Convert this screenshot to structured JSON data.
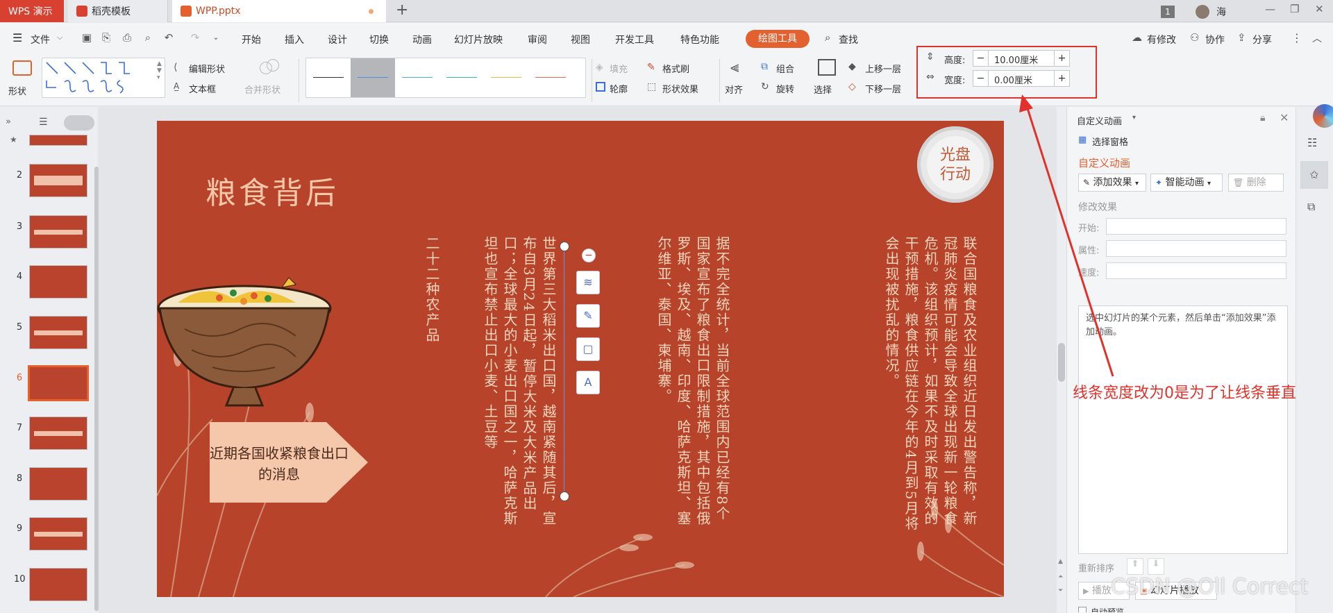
{
  "tabs": {
    "app": "WPS 演示",
    "template": "稻壳模板",
    "file": "WPP.pptx",
    "new_tab": "+"
  },
  "titlebar": {
    "page_badge": "1",
    "user": "海"
  },
  "menu": {
    "file": "文件",
    "items": [
      "开始",
      "插入",
      "设计",
      "切换",
      "动画",
      "幻灯片放映",
      "审阅",
      "视图",
      "开发工具",
      "特色功能"
    ],
    "active": "绘图工具",
    "search": "查找",
    "right": {
      "modified": "有修改",
      "collab": "协作",
      "share": "分享"
    }
  },
  "toolbar": {
    "shape": "形状",
    "edit_shape": "编辑形状",
    "textbox": "文本框",
    "merge_shape": "合并形状",
    "fill": "填充",
    "format_brush": "格式刷",
    "outline": "轮廓",
    "shape_effect": "形状效果",
    "align": "对齐",
    "group": "组合",
    "rotate": "旋转",
    "select": "选择",
    "bring_forward": "上移一层",
    "send_backward": "下移一层",
    "height_label": "高度:",
    "height_value": "10.00厘米",
    "width_label": "宽度:",
    "width_value": "0.00厘米",
    "minus": "−",
    "plus": "+"
  },
  "line_styles": [
    "#333333",
    "#4a90d9",
    "#4bb3c8",
    "#3bb8a0",
    "#e8b84a",
    "#e06a4a"
  ],
  "slides": {
    "numbers": [
      "2",
      "3",
      "4",
      "5",
      "6",
      "7",
      "8",
      "9",
      "10"
    ],
    "selected": "6"
  },
  "slide": {
    "title": "粮食背后",
    "badge_line1": "光盘",
    "badge_line2": "行动",
    "callout": "近期各国收紧粮食出口的消息",
    "col1": "联合国粮食及农业组织近日发出警告称，新冠肺炎疫情可能会导致全球出现新一轮粮食危机。该组织预计，如果不及时采取有效的干预措施，粮食供应链在今年的4月到5月将会出现被扰乱的情况。",
    "col2": "据不完全统计，当前全球范围内已经有8个国家宣布了粮食出口限制措施，其中包括俄罗斯、埃及、越南、印度、哈萨克斯坦、塞尔维亚、泰国、柬埔寨。",
    "col3": "世界第三大稻米出口国，越南紧随其后，宣布自3月24日起，暂停大米及大米产品出口；全球最大的小麦出口国之一，哈萨克斯坦也宣布禁止出口小麦、土豆等",
    "col4": "二十二种农产品"
  },
  "right_panel": {
    "title": "自定义动画",
    "selection_pane": "选择窗格",
    "section": "自定义动画",
    "add_effect": "添加效果",
    "smart_anim": "智能动画",
    "delete": "删除",
    "modify": "修改效果",
    "start": "开始:",
    "property": "属性:",
    "speed": "速度:",
    "hint": "选中幻灯片的某个元素，然后单击“添加效果”添加动画。",
    "reorder": "重新排序",
    "play": "播放",
    "slideshow": "幻灯片播放",
    "autopreview": "自动预览"
  },
  "annotation": "线条宽度改为0是为了让线条垂直",
  "watermark": "CSDN @Oll Correct"
}
